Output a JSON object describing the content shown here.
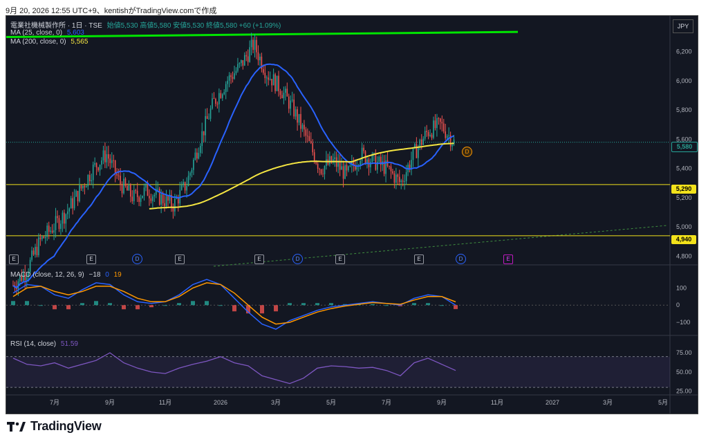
{
  "header": {
    "attribution": "9月 20, 2026 12:55 UTC+9、kentishがTradingView.comで作成"
  },
  "legend": {
    "symbol": "電業社機械製作所 · 1日 · TSE",
    "ohlc": "始値5,530 高値5,580 安値5,530 終値5,580 +60 (+1.09%)",
    "ma25_label": "MA (25, close, 0)",
    "ma25_value": "5,603",
    "ma200_label": "MA (200, close, 0)",
    "ma200_value": "5,565",
    "macd_label": "MACD (close, 12, 26, 9)",
    "macd_hist": "−18",
    "macd_line": "0",
    "macd_signal": "19",
    "rsi_label": "RSI (14, close)",
    "rsi_value": "51.59"
  },
  "price_axis": {
    "currency": "JPY",
    "last_price": "5,580",
    "level_1": "5,290",
    "level_2": "4,940"
  },
  "event_markers": {
    "earnings": "E",
    "dividend": "D"
  },
  "brand": "TradingView",
  "colors": {
    "background": "#131722",
    "up": "#26a69a",
    "down": "#ef5350",
    "ma25": "#2962ff",
    "ma200": "#f5e642",
    "trendline": "#00e600",
    "level": "#f2e21b",
    "rsi": "#7e57c2"
  },
  "chart_data": [
    {
      "type": "line",
      "title": "電業社機械製作所 · 1日 · TSE",
      "pane": "price",
      "x_ticks": [
        "7月",
        "9月",
        "11月",
        "2026",
        "3月",
        "5月",
        "7月",
        "9月",
        "11月",
        "2027",
        "3月",
        "5月"
      ],
      "y_ticks": [
        "4,800",
        "5,000",
        "5,200",
        "5,400",
        "5,600",
        "5,800",
        "6,000",
        "6,200"
      ],
      "ylim": [
        4750,
        6350
      ],
      "candles_approx_close": [
        4600,
        4700,
        4900,
        5000,
        5100,
        5250,
        5400,
        5500,
        5300,
        5200,
        5250,
        5200,
        5150,
        5300,
        5600,
        5850,
        6000,
        6100,
        6250,
        6050,
        5950,
        5800,
        5600,
        5400,
        5450,
        5350,
        5500,
        5450,
        5400,
        5300,
        5500,
        5650,
        5700,
        5580
      ],
      "series": [
        {
          "name": "MA (25, close, 0)",
          "last": 5603
        },
        {
          "name": "MA (200, close, 0)",
          "last": 5565
        }
      ],
      "horizontal_levels": [
        5290,
        4940
      ],
      "last_close": 5580,
      "grid": false
    },
    {
      "type": "bar",
      "title": "MACD (close, 12, 26, 9)",
      "pane": "macd",
      "y_ticks": [
        "100",
        "0",
        "−100"
      ],
      "ylim": [
        -160,
        170
      ],
      "macd": [
        70,
        120,
        110,
        60,
        40,
        90,
        130,
        120,
        60,
        20,
        10,
        20,
        60,
        120,
        150,
        120,
        40,
        -40,
        -110,
        -140,
        -90,
        -60,
        -30,
        -10,
        0,
        10,
        20,
        10,
        0,
        40,
        60,
        50,
        0
      ],
      "signal": [
        50,
        100,
        110,
        80,
        60,
        80,
        110,
        110,
        80,
        40,
        20,
        20,
        50,
        100,
        130,
        120,
        70,
        0,
        -70,
        -110,
        -100,
        -70,
        -40,
        -20,
        -5,
        5,
        15,
        10,
        5,
        30,
        50,
        50,
        19
      ],
      "last": {
        "histogram": -18,
        "macd": 0,
        "signal": 19
      }
    },
    {
      "type": "line",
      "title": "RSI (14, close)",
      "pane": "rsi",
      "y_ticks": [
        "75.00",
        "50.00",
        "25.00"
      ],
      "ylim": [
        22,
        85
      ],
      "bands": [
        70,
        30
      ],
      "values": [
        68,
        60,
        58,
        62,
        55,
        60,
        65,
        75,
        62,
        55,
        50,
        48,
        55,
        60,
        64,
        70,
        62,
        58,
        45,
        40,
        35,
        42,
        55,
        58,
        57,
        55,
        56,
        52,
        45,
        62,
        68,
        60,
        52
      ],
      "last": 51.59
    }
  ]
}
